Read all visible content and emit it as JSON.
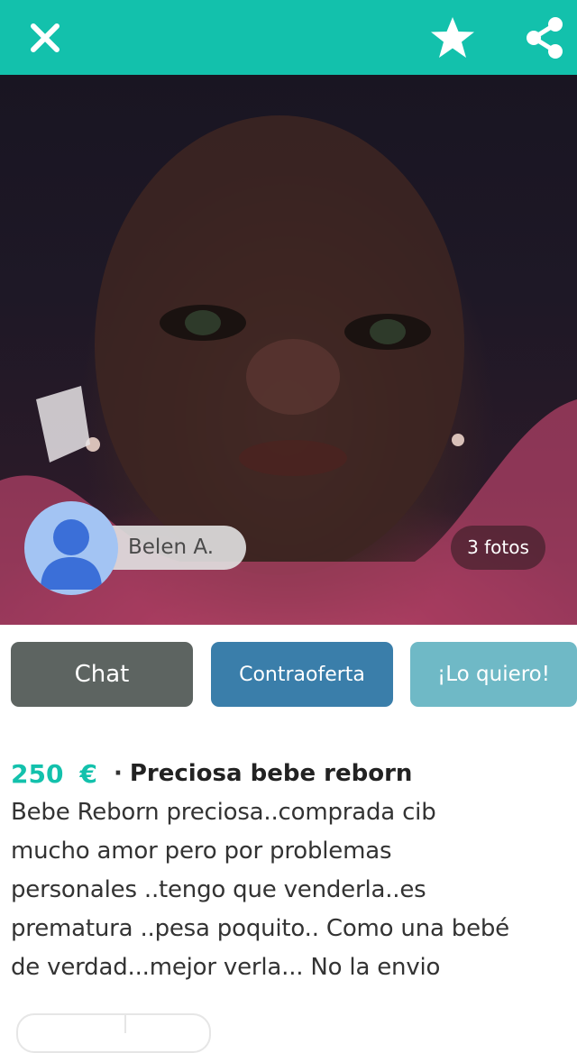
{
  "header": {
    "close_icon": "close-icon",
    "favorite_icon": "star-icon",
    "share_icon": "share-icon",
    "background_color": "#13c1ac"
  },
  "listing": {
    "seller_name": "Belen A.",
    "photos_count": "3 fotos",
    "price": "250",
    "currency": "€",
    "separator": "·",
    "title": "Preciosa bebe reborn",
    "description": "Bebe Reborn preciosa..comprada cib\nmucho amor pero por problemas\npersonales ..tengo que venderla..es\nprematura ..pesa poquito.. Como una bebé\nde verdad...mejor verla... No la envio"
  },
  "actions": {
    "chat_label": "Chat",
    "counteroffer_label": "Contraoferta",
    "want_label": "¡Lo quiero!",
    "chat_color": "#5d6461",
    "counteroffer_color": "#3a7eaa",
    "want_color": "#6fb9c6"
  },
  "colors": {
    "accent": "#13c1ac"
  }
}
